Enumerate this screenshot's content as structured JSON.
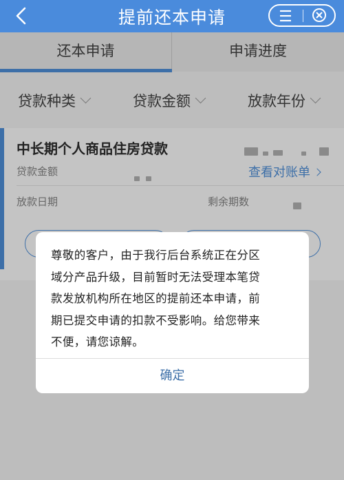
{
  "header": {
    "title": "提前还本申请"
  },
  "tabs": [
    {
      "label": "还本申请",
      "active": true
    },
    {
      "label": "申请进度",
      "active": false
    }
  ],
  "filters": [
    {
      "label": "贷款种类"
    },
    {
      "label": "贷款金额"
    },
    {
      "label": "放款年份"
    }
  ],
  "loan_card": {
    "product_name": "中长期个人商品住房贷款",
    "amount_label": "贷款金额",
    "view_statement_label": "查看对账单",
    "disbursement_date_label": "放款日期",
    "remaining_terms_label": "剩余期数"
  },
  "dialog": {
    "message_lines": [
      "尊敬的客户，由于我行后台系统正在分区",
      "域分产品升级，目前暂时无法受理本笔贷",
      "款发放机构所在地区的提前还本申请，前",
      "期已提交申请的扣款不受影响。给您带来",
      "不便，请您谅解。"
    ],
    "confirm_label": "确定"
  },
  "colors": {
    "header_bg": "#4a8bdc",
    "accent": "#3d6fa8",
    "overlay_bg": "#bdbdbd"
  }
}
